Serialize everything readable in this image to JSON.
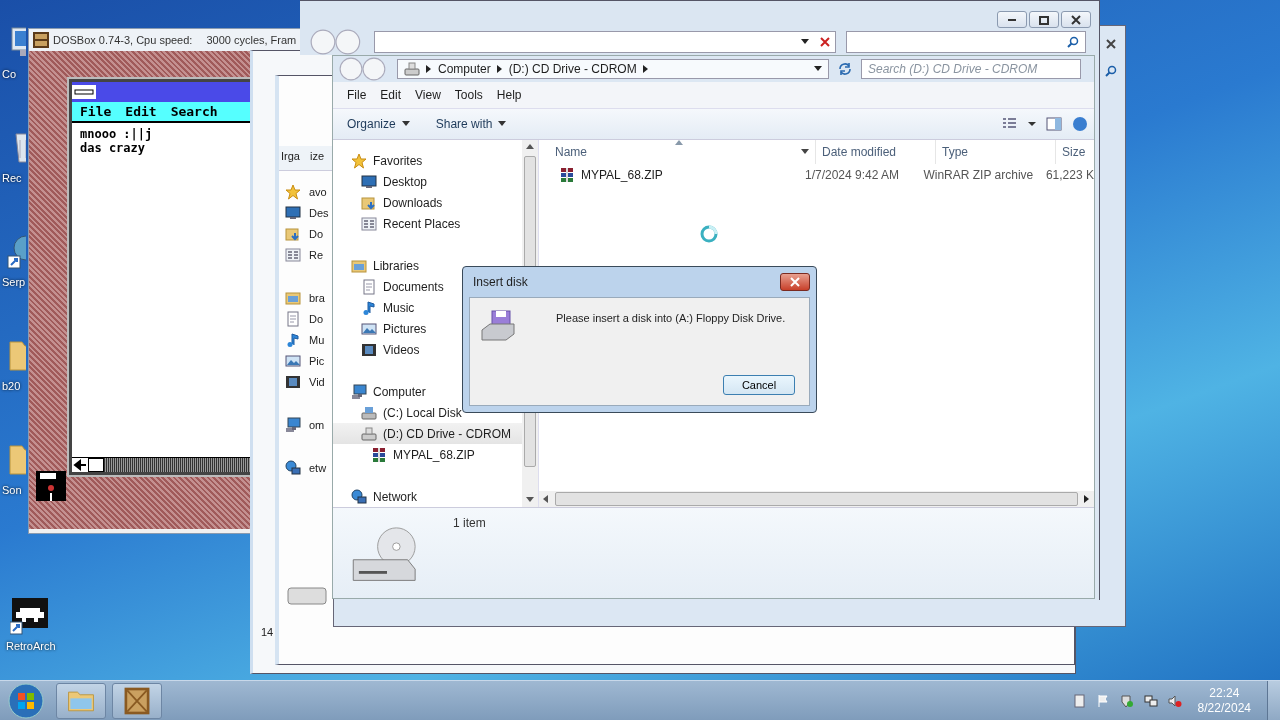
{
  "desktop_icons": [
    {
      "label": "Co",
      "kind": "computer"
    },
    {
      "label": "Rec",
      "kind": "recycle"
    },
    {
      "label": "Serp",
      "kind": "shortcut"
    },
    {
      "label": "b20",
      "kind": "folder"
    },
    {
      "label": "Son",
      "kind": "folder"
    },
    {
      "label": "RetroArch",
      "kind": "retroarch"
    }
  ],
  "dosbox": {
    "title": "DOSBox 0.74-3, Cpu speed:",
    "speed": "3000 cycles, Fram",
    "menu": [
      "File",
      "Edit",
      "Search"
    ],
    "lines": [
      "mnooo :||j",
      "das crazy"
    ]
  },
  "background_window": {
    "status_fragment": "14"
  },
  "background_window_2": {
    "toolbar_fragments": [
      "Irga",
      "ize"
    ],
    "nav_groups": [
      [
        {
          "label": "avo",
          "kind": "star"
        },
        {
          "label": "Des",
          "kind": "desktop"
        },
        {
          "label": "Do",
          "kind": "downloads"
        },
        {
          "label": "Re",
          "kind": "recent"
        }
      ],
      [
        {
          "label": "bra",
          "kind": "library"
        },
        {
          "label": "Do",
          "kind": "documents"
        },
        {
          "label": "Mu",
          "kind": "music"
        },
        {
          "label": "Pic",
          "kind": "pictures"
        },
        {
          "label": "Vid",
          "kind": "videos"
        }
      ],
      [
        {
          "label": "om",
          "kind": "computer"
        }
      ],
      [
        {
          "label": "etw",
          "kind": "network"
        }
      ]
    ]
  },
  "explorer": {
    "breadcrumb": [
      "Computer",
      "(D:) CD Drive - CDROM"
    ],
    "search_placeholder": "Search (D:) CD Drive - CDROM",
    "menu": [
      "File",
      "Edit",
      "View",
      "Tools",
      "Help"
    ],
    "toolbar": [
      "Organize",
      "Share with"
    ],
    "nav": [
      {
        "label": "Favorites",
        "kind": "star",
        "selected": false,
        "children": [
          {
            "label": "Desktop",
            "kind": "desktop",
            "selected": false
          },
          {
            "label": "Downloads",
            "kind": "downloads",
            "selected": false
          },
          {
            "label": "Recent Places",
            "kind": "recent",
            "selected": false
          }
        ]
      },
      {
        "label": "Libraries",
        "kind": "library",
        "selected": false,
        "children": [
          {
            "label": "Documents",
            "kind": "documents",
            "selected": false
          },
          {
            "label": "Music",
            "kind": "music",
            "selected": false
          },
          {
            "label": "Pictures",
            "kind": "pictures",
            "selected": false
          },
          {
            "label": "Videos",
            "kind": "videos",
            "selected": false
          }
        ]
      },
      {
        "label": "Computer",
        "kind": "computer",
        "selected": false,
        "children": [
          {
            "label": "(C:) Local Disk",
            "kind": "disk",
            "selected": false
          },
          {
            "label": "(D:) CD Drive - CDROM",
            "kind": "cdrom",
            "selected": true,
            "children": [
              {
                "label": "MYPAL_68.ZIP",
                "kind": "zip",
                "selected": false
              }
            ]
          }
        ]
      },
      {
        "label": "Network",
        "kind": "network",
        "selected": false
      }
    ],
    "columns": [
      "Name",
      "Date modified",
      "Type",
      "Size"
    ],
    "rows": [
      {
        "name": "MYPAL_68.ZIP",
        "date": "1/7/2024 9:42 AM",
        "type": "WinRAR ZIP archive",
        "size": "61,223 K",
        "selected": false
      }
    ],
    "status": "1 item"
  },
  "dialog": {
    "title": "Insert disk",
    "message": "Please insert a disk into (A:) Floppy Disk Drive.",
    "button": "Cancel"
  },
  "taskbar": {
    "apps": [
      {
        "kind": "explorer"
      },
      {
        "kind": "dosbox"
      }
    ],
    "time": "22:24",
    "date": "8/22/2024"
  }
}
